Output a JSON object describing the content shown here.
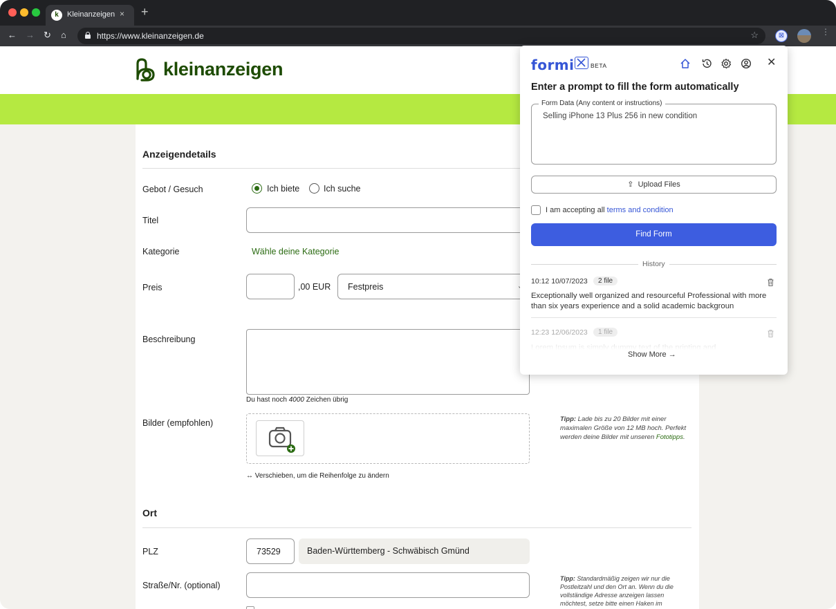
{
  "browser": {
    "tab_title": "Kleinanzeigen",
    "tab_close": "×",
    "new_tab": "+",
    "url": "https://www.kleinanzeigen.de",
    "back": "←",
    "forward": "→",
    "reload": "↻",
    "home": "⌂",
    "bookmark_star": "☆",
    "menu": "⋮",
    "colors": {
      "close": "#ff5f57",
      "minimize": "#febc2e",
      "maximize": "#28c840"
    }
  },
  "site": {
    "logo_text": "kleinanzeigen",
    "section_details": "Anzeigendetails",
    "gebot_label": "Gebot / Gesuch",
    "radio_offer": "Ich biete",
    "radio_search": "Ich suche",
    "title_label": "Titel",
    "title_value": "",
    "category_label": "Kategorie",
    "category_link": "Wähle deine Kategorie",
    "price_label": "Preis",
    "price_value": "",
    "price_suffix": ",00 EUR",
    "price_type": "Festpreis",
    "description_label": "Beschreibung",
    "chars_prefix": "Du hast noch ",
    "chars_count": "4000",
    "chars_suffix": " Zeichen übrig",
    "images_label": "Bilder (empfohlen)",
    "images_tip_bold": "Tipp:",
    "images_tip": " Lade bis zu 20 Bilder mit einer maximalen Größe von 12 MB hoch. Perfekt werden deine Bilder mit unseren ",
    "images_tip_link": "Fototipps",
    "images_tip_end": ".",
    "reorder_hint": "↔ Verschieben, um die Reihenfolge zu ändern",
    "section_location": "Ort",
    "plz_label": "PLZ",
    "plz_value": "73529",
    "location_value": "Baden-Württemberg - Schwäbisch Gmünd",
    "street_label": "Straße/Nr. (optional)",
    "street_tip_bold": "Tipp:",
    "street_tip": " Standardmäßig zeigen wir nur die Postleitzahl und den Ort an. Wenn du die vollständige Adresse anzeigen lassen möchtest, setze bitte einen Haken im",
    "colors": {
      "brand": "#1d4b00",
      "band": "#b5e941",
      "link": "#2b6b12"
    }
  },
  "formi": {
    "logo": "formi",
    "badge": "BETA",
    "close": "✕",
    "headline": "Enter a prompt to fill the form automatically",
    "textarea_legend": "Form Data (Any content or instructions)",
    "textarea_value": "Selling iPhone 13 Plus 256 in new condition",
    "upload_label": "Upload Files",
    "accept_prefix": "I am accepting all ",
    "accept_link": "terms and condition",
    "find_button": "Find Form",
    "history_heading": "History",
    "history": [
      {
        "date": "10:12 10/07/2023",
        "files": "2 file",
        "text": "Exceptionally well organized and resourceful Professional with more than six years experience and a solid academic backgroun"
      },
      {
        "date": "12:23 12/06/2023",
        "files": "1 file",
        "text": "Lorem Ipsum is simply dummy text of the printing and"
      }
    ],
    "show_more": "Show More →",
    "colors": {
      "accent": "#3d5de0"
    },
    "icons": [
      "home-icon",
      "history-icon",
      "settings-icon",
      "account-icon"
    ]
  }
}
